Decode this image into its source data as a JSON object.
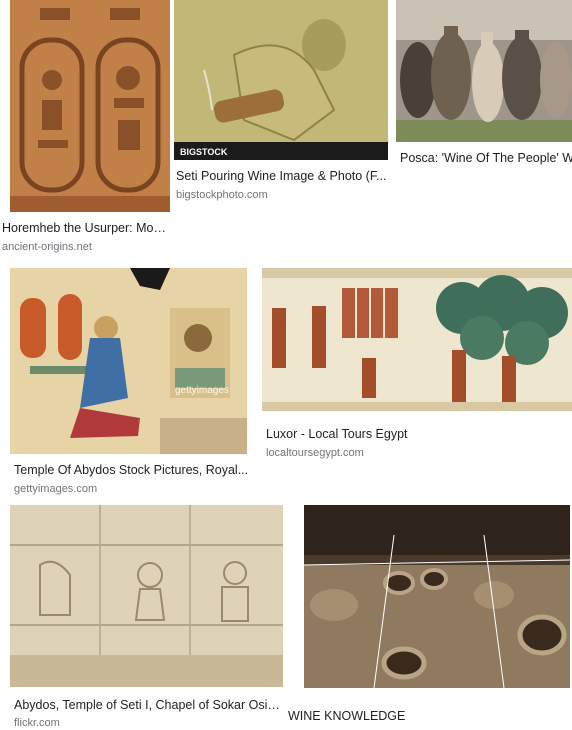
{
  "results": [
    {
      "title": "Horemheb the Usurper: Monu...",
      "source": "ancient-origins.net",
      "image": "carved-hieroglyph-cartouches"
    },
    {
      "title": "Seti Pouring Wine Image & Photo (F...",
      "source": "bigstockphoto.com",
      "image": "relief-pouring-wine",
      "watermark": "BIGSTOCK"
    },
    {
      "title": "Posca: 'Wine Of The People' Wa",
      "source": "",
      "image": "clay-amphorae"
    },
    {
      "title": "Temple Of Abydos Stock Pictures, Royal...",
      "source": "gettyimages.com",
      "image": "painted-temple-relief",
      "watermark": "gettyimages"
    },
    {
      "title": "Luxor - Local Tours Egypt",
      "source": "localtoursegypt.com",
      "image": "wine-harvest-painting"
    },
    {
      "title": "Abydos, Temple of Seti I, Chapel of Sokar Osiri...",
      "source": "flickr.com",
      "image": "carved-stone-relief"
    },
    {
      "title": "WINE KNOWLEDGE",
      "source": "",
      "image": "excavated-wine-jars"
    }
  ],
  "colors": {
    "title": "#222222",
    "source": "#70757a"
  }
}
